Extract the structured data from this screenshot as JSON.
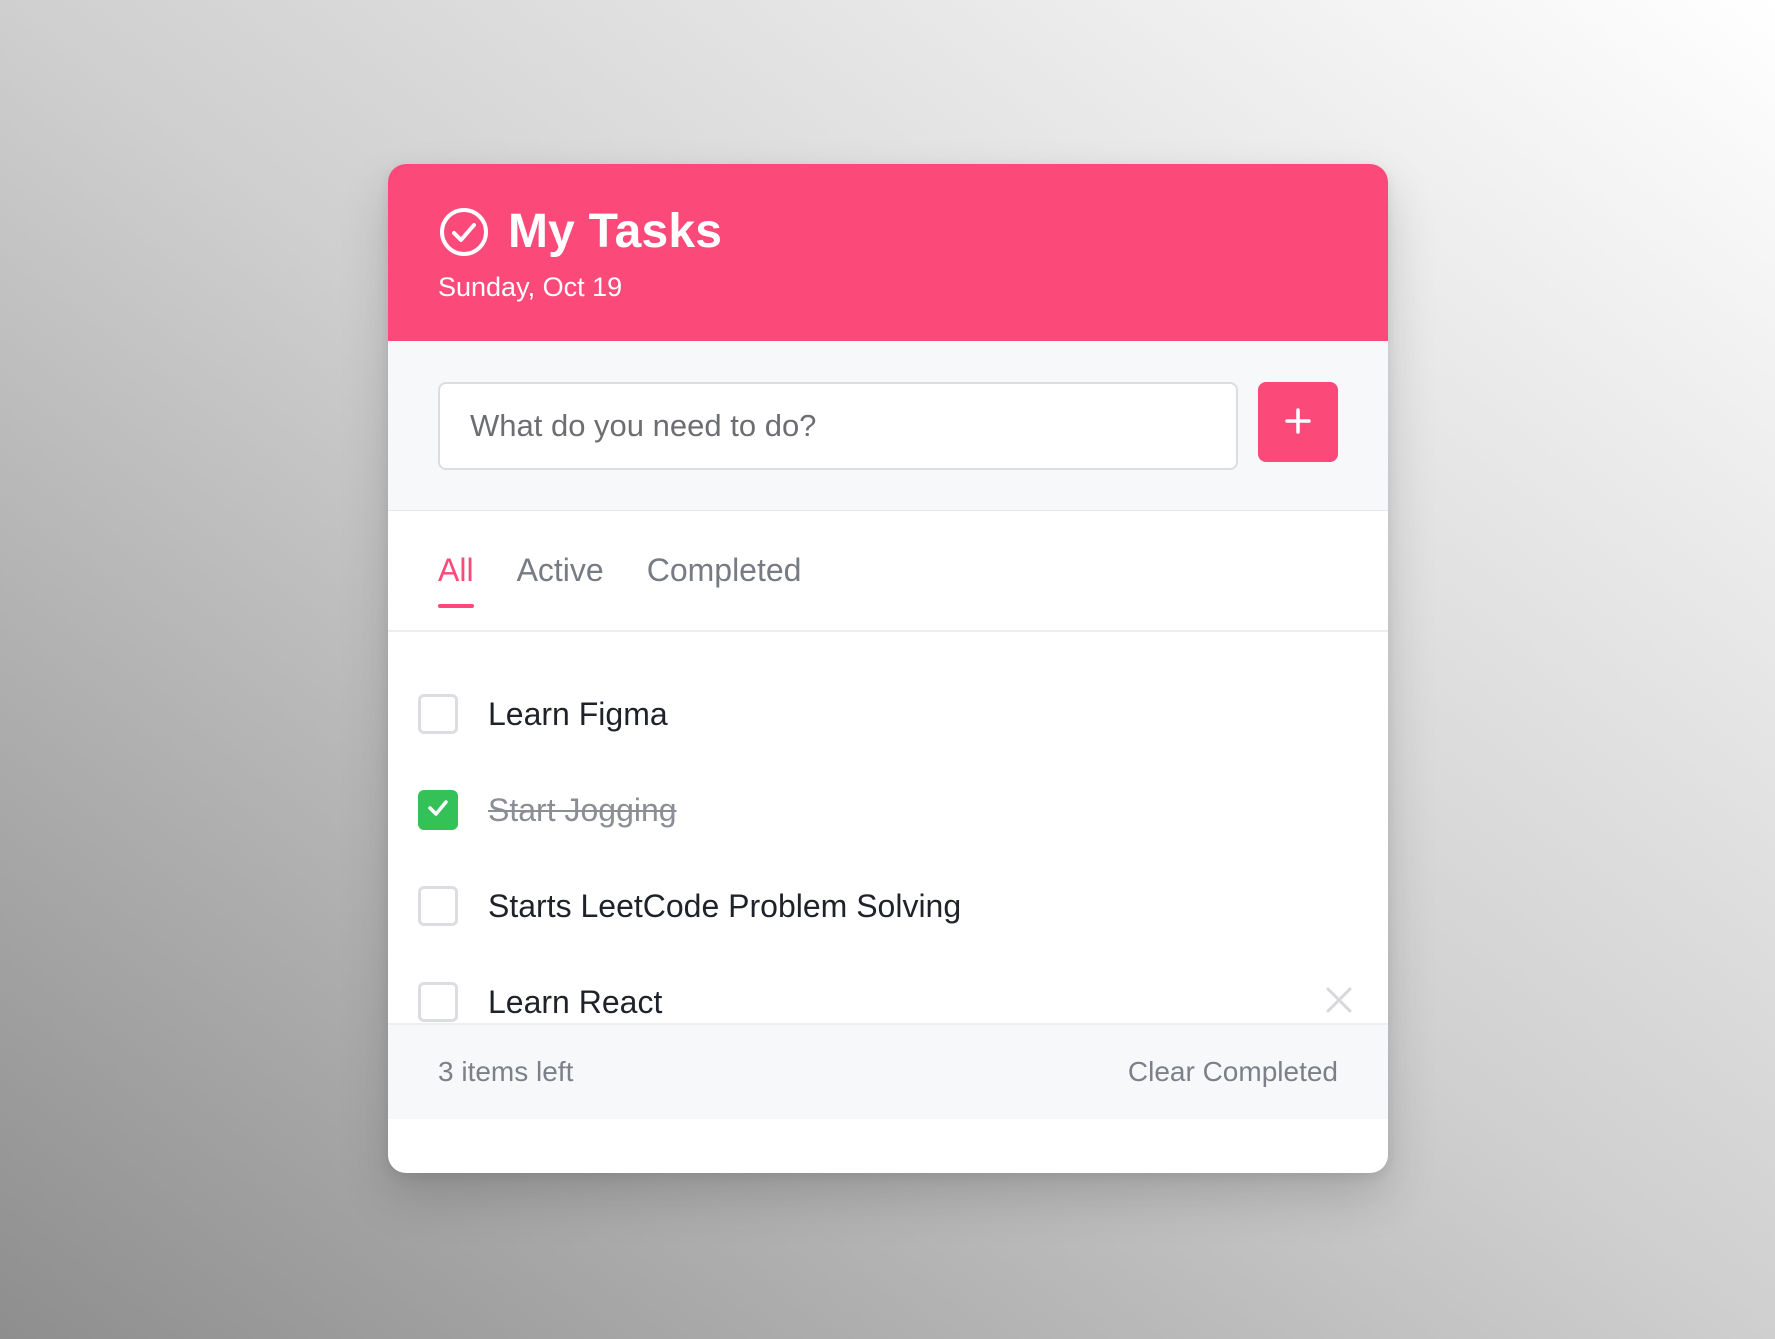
{
  "header": {
    "title": "My Tasks",
    "date": "Sunday, Oct 19",
    "icon": "check-circle-icon",
    "background_color": "#fb4a79"
  },
  "new_task": {
    "placeholder": "What do you need to do?",
    "value": "",
    "add_button_icon": "plus-icon"
  },
  "tabs": [
    {
      "label": "All",
      "active": true
    },
    {
      "label": "Active",
      "active": false
    },
    {
      "label": "Completed",
      "active": false
    }
  ],
  "tasks": [
    {
      "label": "Learn Figma",
      "completed": false
    },
    {
      "label": "Start Jogging",
      "completed": true
    },
    {
      "label": "Starts LeetCode Problem Solving",
      "completed": false
    },
    {
      "label": "Learn React",
      "completed": false,
      "delete_icon": "close-icon"
    }
  ],
  "footer": {
    "items_left": "3 items left",
    "clear_completed": "Clear Completed"
  },
  "colors": {
    "accent": "#fb4a79",
    "checked": "#33c158",
    "muted_text": "#7b8089"
  }
}
